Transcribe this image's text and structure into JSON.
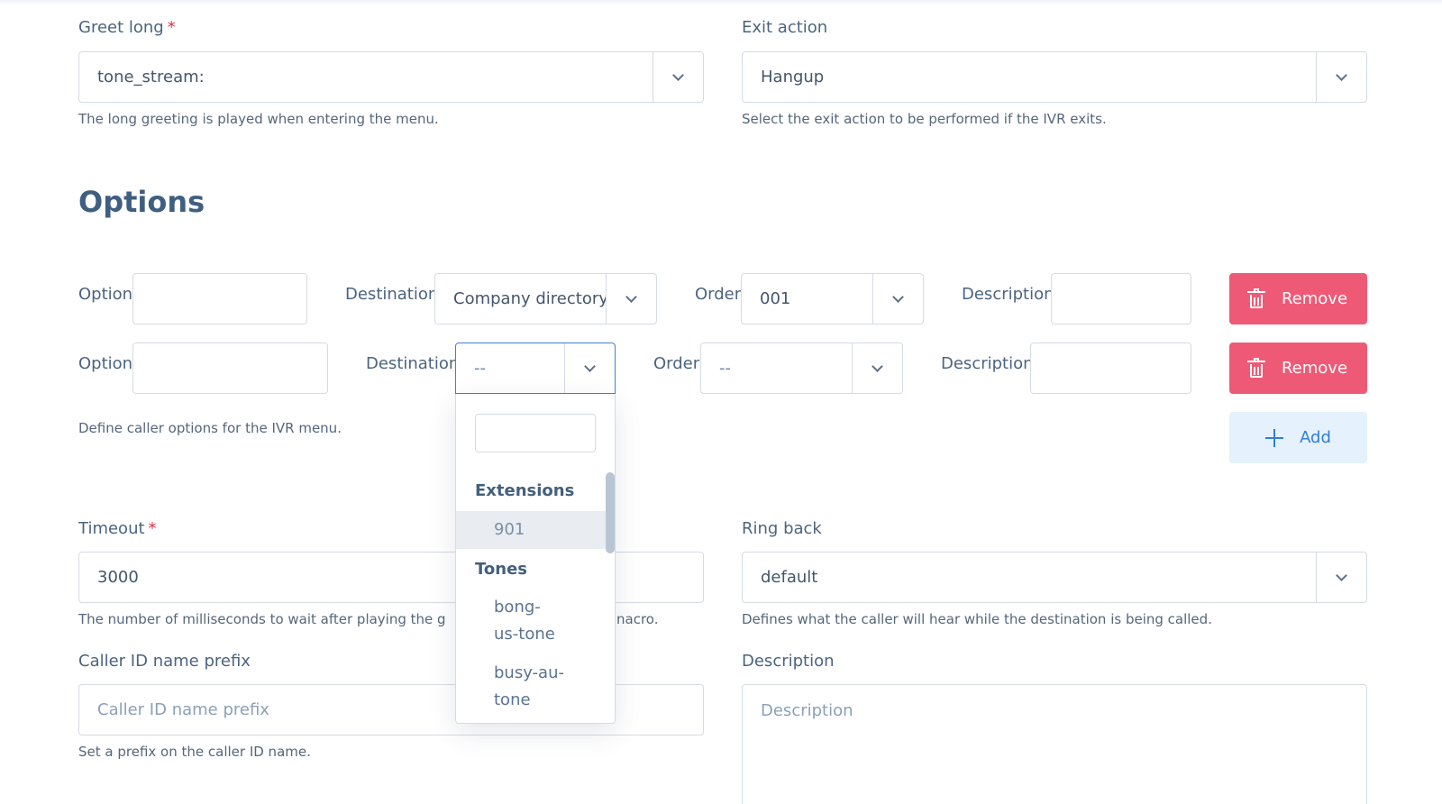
{
  "greet_long": {
    "label": "Greet long",
    "required_mark": "*",
    "value": "tone_stream:",
    "help": "The long greeting is played when entering the menu."
  },
  "exit_action": {
    "label": "Exit action",
    "value": "Hangup",
    "help": "Select the exit action to be performed if the IVR exits."
  },
  "options_section": {
    "title": "Options",
    "help": "Define caller options for the IVR menu.",
    "add_label": "Add",
    "rows": [
      {
        "option_label": "Option",
        "option_value": "",
        "destination_label": "Destination",
        "destination_value": "Company directory",
        "order_label": "Order",
        "order_value": "001",
        "description_label": "Description",
        "description_value": "",
        "remove_label": "Remove"
      },
      {
        "option_label": "Option",
        "option_value": "",
        "destination_label": "Destination",
        "destination_value": "--",
        "order_label": "Order",
        "order_value": "--",
        "description_label": "Description",
        "description_value": "",
        "remove_label": "Remove"
      }
    ]
  },
  "destination_dropdown": {
    "search_value": "",
    "groups": [
      {
        "label": "Extensions",
        "items": [
          "901"
        ]
      },
      {
        "label": "Tones",
        "items": [
          "bong-us-tone",
          "busy-au-tone"
        ]
      }
    ],
    "item_lines": {
      "bong_1": "bong-",
      "bong_2": "us-tone",
      "busy_1": "busy-au-",
      "busy_2": "tone"
    },
    "highlighted": "901"
  },
  "timeout": {
    "label": "Timeout",
    "required_mark": "*",
    "value": "3000",
    "help_left": "The number of milliseconds to wait after playing the g",
    "help_right": "nacro."
  },
  "ring_back": {
    "label": "Ring back",
    "value": "default",
    "help": "Defines what the caller will hear while the destination is being called."
  },
  "caller_id_prefix": {
    "label": "Caller ID name prefix",
    "placeholder": "Caller ID name prefix",
    "help": "Set a prefix on the caller ID name."
  },
  "description": {
    "label": "Description",
    "placeholder": "Description"
  }
}
